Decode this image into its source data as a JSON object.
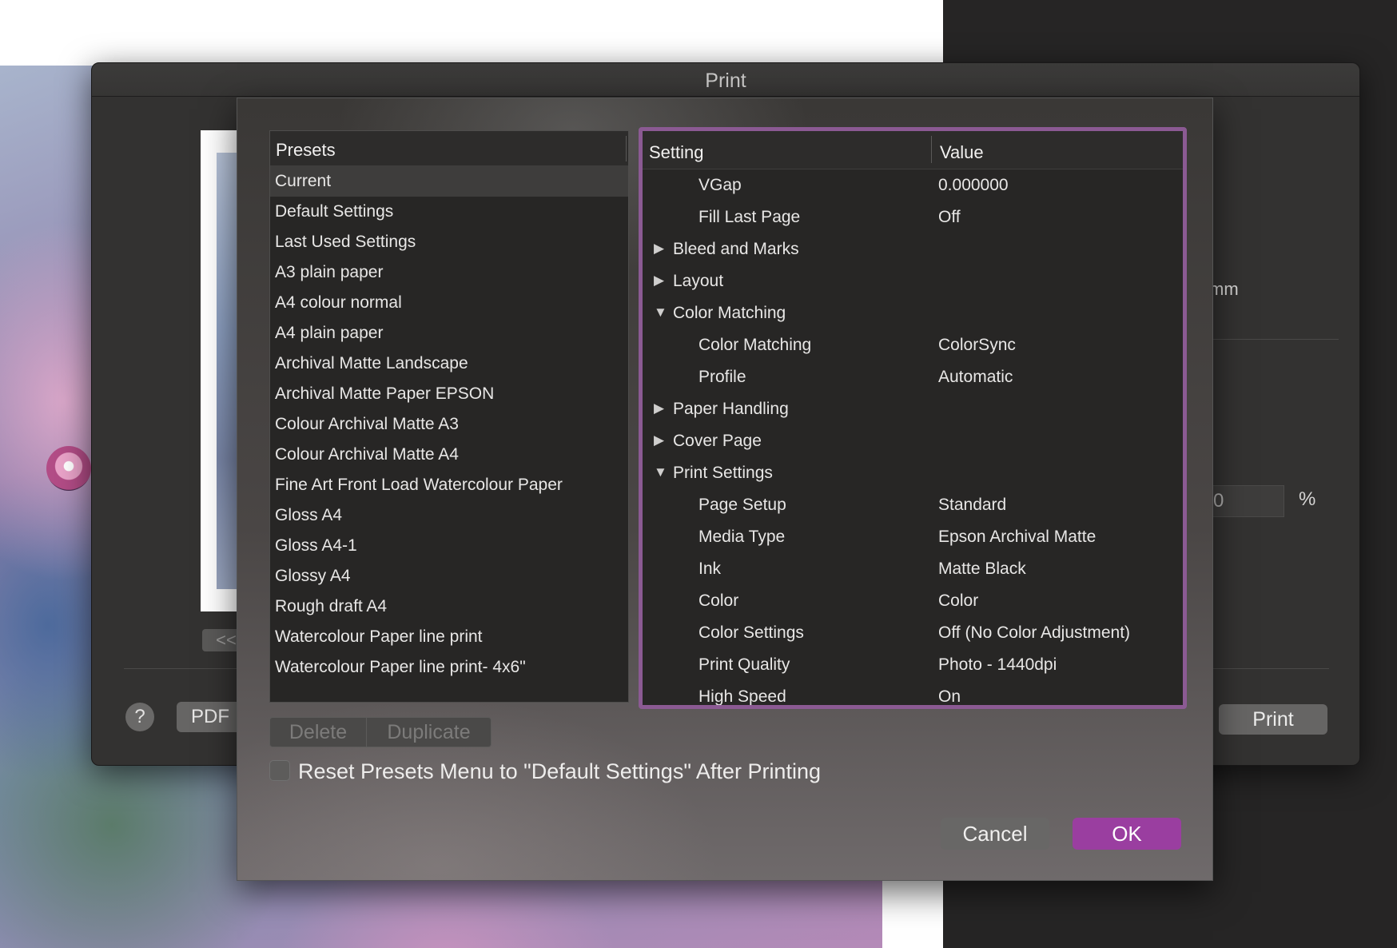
{
  "print_window": {
    "title": "Print",
    "preview_nav": "<<",
    "help_label": "?",
    "pdf_label": "PDF",
    "print_label": "Print",
    "mm_label": "mm",
    "scale_value": "0",
    "percent_label": "%"
  },
  "presets": {
    "header": "Presets",
    "items": [
      "Current",
      "Default Settings",
      "Last Used Settings",
      "A3 plain paper",
      "A4 colour normal",
      "A4 plain paper",
      "Archival Matte Landscape",
      "Archival Matte Paper EPSON",
      "Colour Archival Matte A3",
      "Colour Archival Matte A4",
      "Fine Art Front Load Watercolour Paper",
      "Gloss A4",
      "Gloss A4-1",
      "Glossy A4",
      "Rough draft A4",
      "Watercolour Paper line print",
      "Watercolour Paper line print- 4x6\""
    ],
    "selected": "Current",
    "delete_label": "Delete",
    "duplicate_label": "Duplicate",
    "reset_label": "Reset Presets Menu to \"Default Settings\" After Printing",
    "reset_checked": false,
    "cancel_label": "Cancel",
    "ok_label": "OK"
  },
  "settings": {
    "header_setting": "Setting",
    "header_value": "Value",
    "rows": [
      {
        "label": "VGap",
        "value": "0.000000",
        "level": 2,
        "arrow": ""
      },
      {
        "label": "Fill Last Page",
        "value": "Off",
        "level": 2,
        "arrow": ""
      },
      {
        "label": "Bleed and Marks",
        "value": "",
        "level": 1,
        "arrow": "collapsed"
      },
      {
        "label": "Layout",
        "value": "",
        "level": 1,
        "arrow": "collapsed"
      },
      {
        "label": "Color Matching",
        "value": "",
        "level": 1,
        "arrow": "expanded"
      },
      {
        "label": "Color Matching",
        "value": "ColorSync",
        "level": 2,
        "arrow": ""
      },
      {
        "label": "Profile",
        "value": "Automatic",
        "level": 2,
        "arrow": ""
      },
      {
        "label": "Paper Handling",
        "value": "",
        "level": 1,
        "arrow": "collapsed"
      },
      {
        "label": "Cover Page",
        "value": "",
        "level": 1,
        "arrow": "collapsed"
      },
      {
        "label": "Print Settings",
        "value": "",
        "level": 1,
        "arrow": "expanded"
      },
      {
        "label": "Page Setup",
        "value": "Standard",
        "level": 2,
        "arrow": ""
      },
      {
        "label": "Media Type",
        "value": "Epson Archival Matte",
        "level": 2,
        "arrow": ""
      },
      {
        "label": "Ink",
        "value": "Matte Black",
        "level": 2,
        "arrow": ""
      },
      {
        "label": "Color",
        "value": "Color",
        "level": 2,
        "arrow": ""
      },
      {
        "label": "Color Settings",
        "value": "Off (No Color Adjustment)",
        "level": 2,
        "arrow": ""
      },
      {
        "label": "Print Quality",
        "value": "Photo - 1440dpi",
        "level": 2,
        "arrow": ""
      },
      {
        "label": "High Speed",
        "value": "On",
        "level": 2,
        "arrow": ""
      }
    ]
  },
  "colors": {
    "accent": "#9a3ea0",
    "focus_ring": "#8b5a93"
  },
  "icons": {
    "collapsed": "triangle-right-icon",
    "expanded": "triangle-down-icon"
  }
}
